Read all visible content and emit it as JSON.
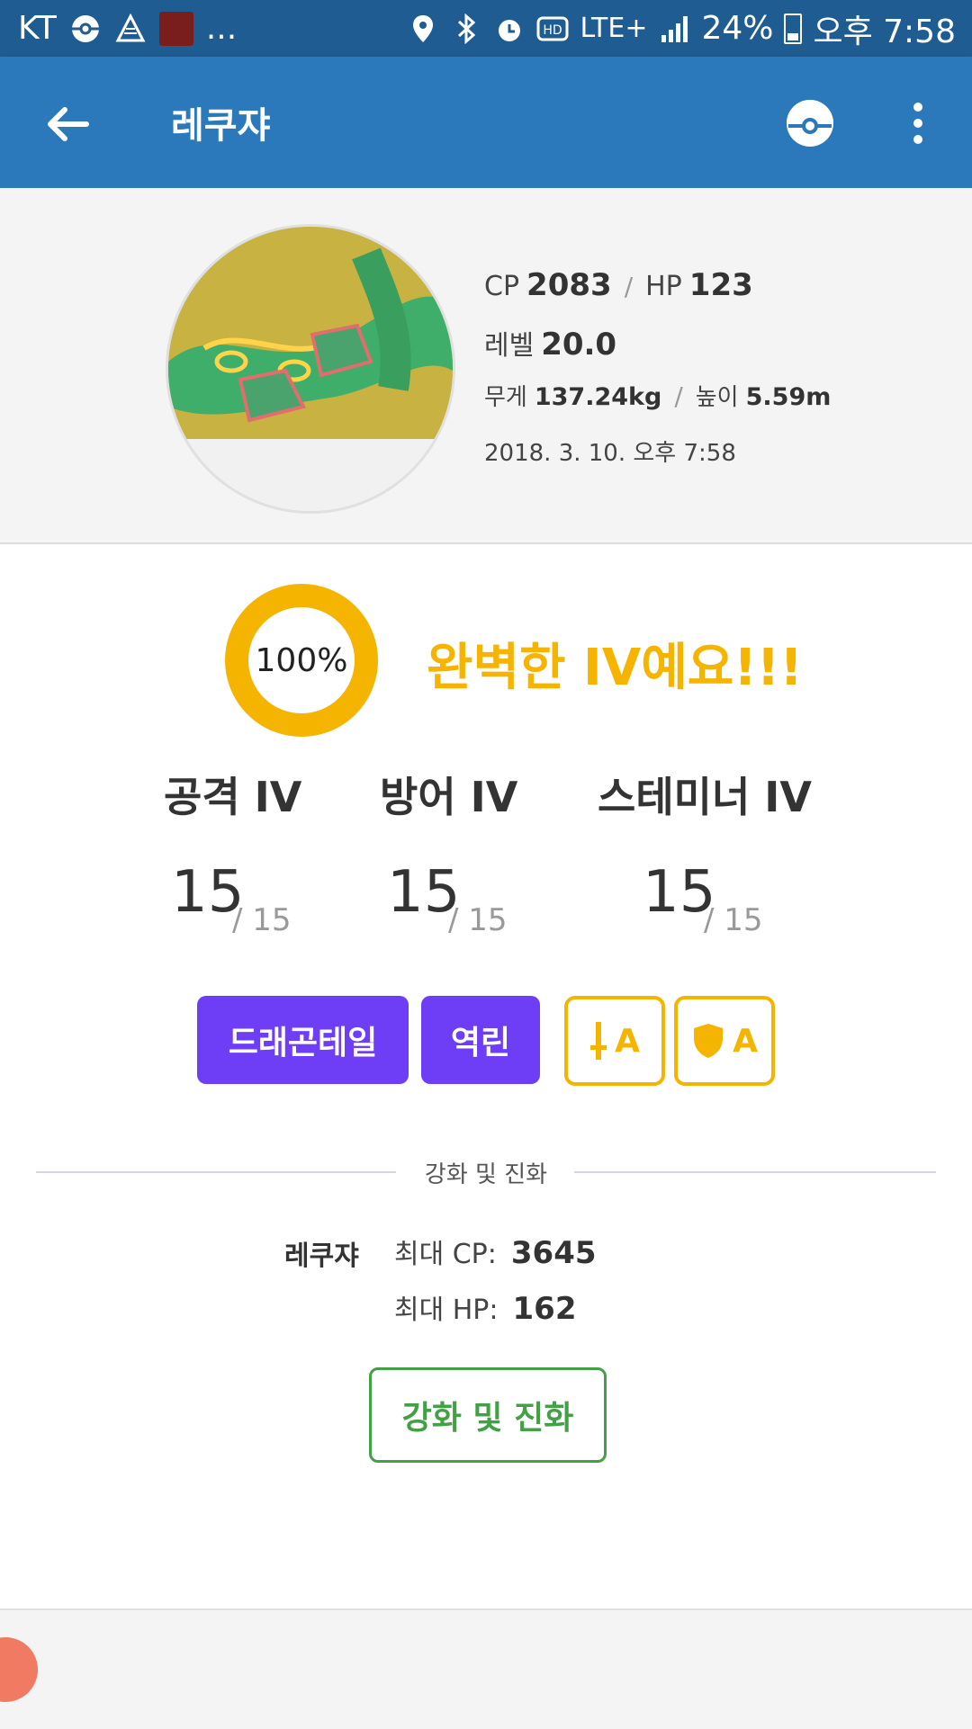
{
  "status_bar": {
    "carrier": "KT",
    "more": "...",
    "network": "LTE+",
    "battery": "24%",
    "time": "오후 7:58"
  },
  "app_bar": {
    "title": "레쿠쟈"
  },
  "pokemon": {
    "cp_label": "CP",
    "cp": "2083",
    "hp_label": "HP",
    "hp": "123",
    "level_label": "레벨",
    "level": "20.0",
    "weight_label": "무게",
    "weight": "137.24kg",
    "height_label": "높이",
    "height": "5.59m",
    "date": "2018. 3. 10. 오후 7:58",
    "separator": "/"
  },
  "iv": {
    "percent": "100%",
    "percent_value": 1.0,
    "message": "완벽한 IV예요!!!",
    "attack": {
      "label": "공격 IV",
      "value": "15",
      "max": "/ 15"
    },
    "defense": {
      "label": "방어 IV",
      "value": "15",
      "max": "/ 15"
    },
    "stamina": {
      "label": "스테미너 IV",
      "value": "15",
      "max": "/ 15"
    }
  },
  "moves": {
    "fast": "드래곤테일",
    "charged": "역린",
    "attack_grade": "A",
    "defense_grade": "A"
  },
  "evolution": {
    "section_label": "강화 및 진화",
    "name": "레쿠쟈",
    "max_cp_label": "최대 CP:",
    "max_cp": "3645",
    "max_hp_label": "최대 HP:",
    "max_hp": "162",
    "button": "강화 및 진화"
  },
  "colors": {
    "status_bar": "#1f5c91",
    "app_bar": "#2b79ba",
    "accent_gold": "#f5b400",
    "move_purple": "#6d3ef5",
    "evolve_green": "#43a047"
  },
  "icons": [
    "back-arrow-icon",
    "pokeball-icon",
    "more-vert-icon",
    "sword-icon",
    "shield-icon"
  ]
}
